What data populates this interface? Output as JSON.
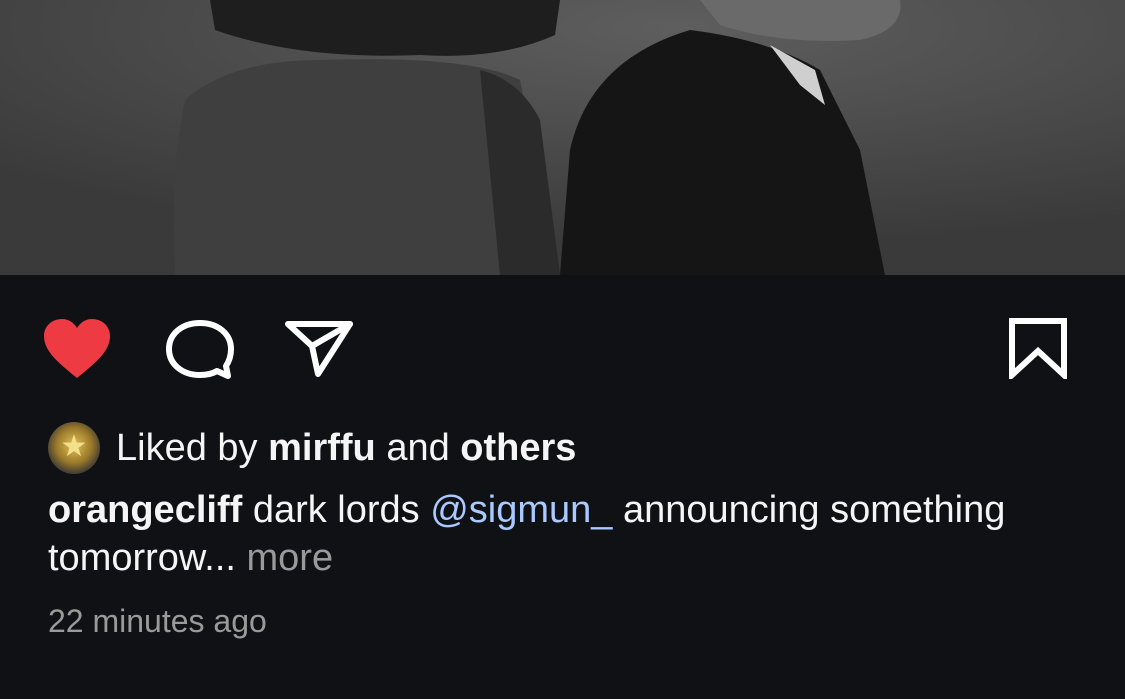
{
  "photo": {
    "alt_icon": "post-photo-image"
  },
  "actions": {
    "like_icon": "heart-filled-icon",
    "like_color": "#ee3a42",
    "comment_icon": "comment-bubble-icon",
    "share_icon": "paper-plane-icon",
    "save_icon": "bookmark-icon"
  },
  "likes": {
    "prefix": "Liked by",
    "user": "mirffu",
    "joiner": "and",
    "others": "others"
  },
  "caption": {
    "username": "orangecliff",
    "text_before": "dark lords",
    "mention": "@sigmun_",
    "text_after": "announcing something tomorrow...",
    "more_label": "more",
    "mention_color": "#a9c9ff"
  },
  "timestamp": "22 minutes ago",
  "colors": {
    "background": "#0f1115",
    "text": "#f5f5f5",
    "muted": "#9a9a9a"
  }
}
